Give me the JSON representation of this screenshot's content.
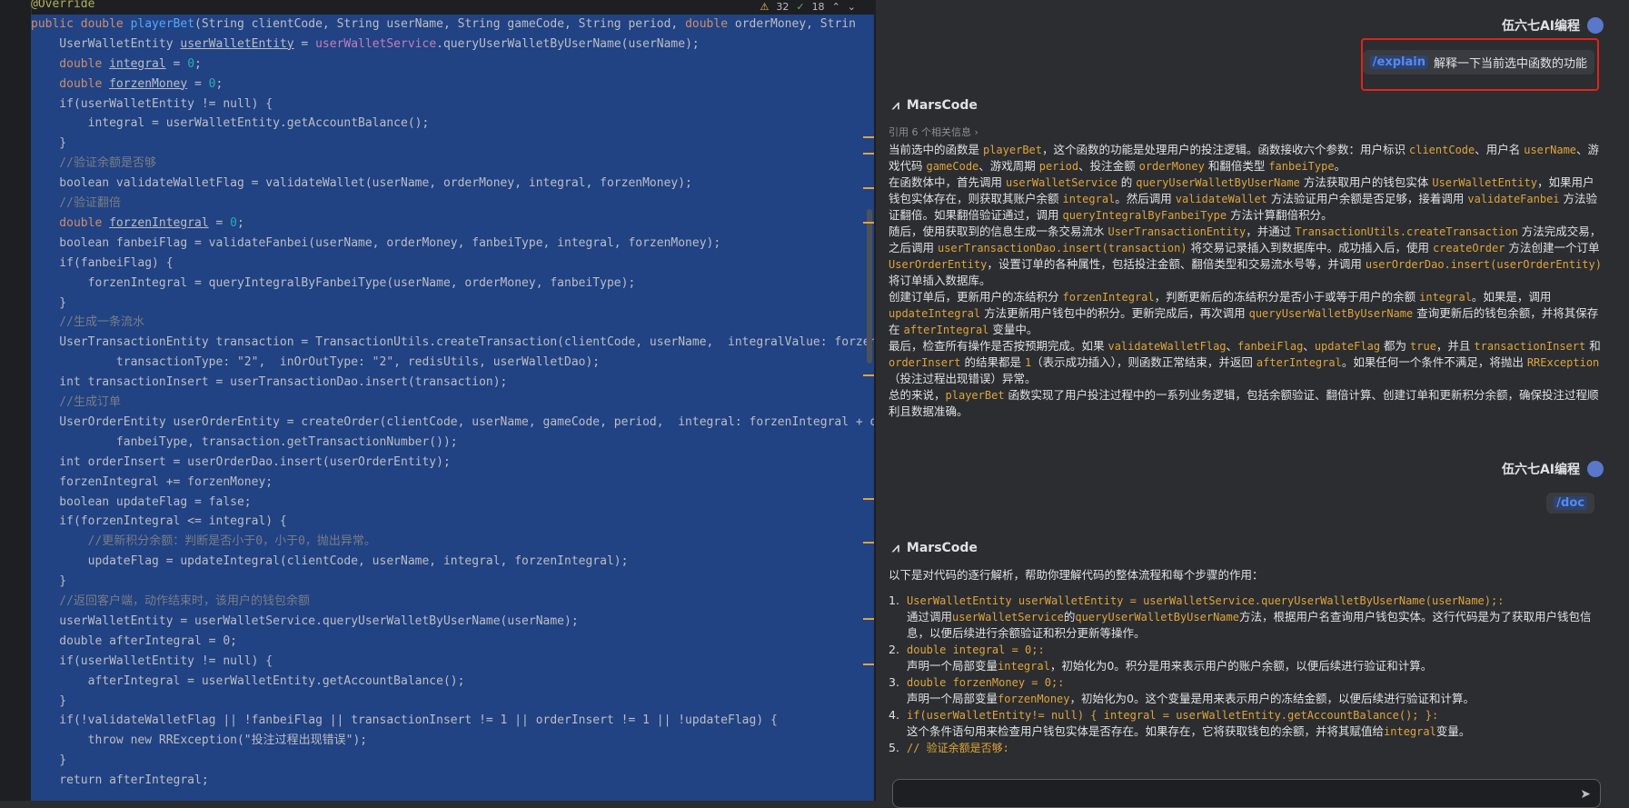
{
  "editor": {
    "inspect": {
      "warnings": "32",
      "ok": "18"
    },
    "lines": [
      {
        "t": "ann",
        "text": "@Override"
      },
      {
        "t": "sig",
        "kw": "public double ",
        "fn": "playerBet",
        "rest": "(String clientCode, String userName, String gameCode, String period, ",
        "kw2": "double ",
        "rest2": "orderMoney, Strin"
      },
      {
        "t": "plain",
        "pre": "    UserWalletEntity ",
        "u": "userWalletEntity",
        "mid": " = ",
        "fld": "userWalletService",
        "post": ".queryUserWalletByUserName(userName);"
      },
      {
        "t": "decl",
        "kw": "    double ",
        "u": "integral",
        "post": " = ",
        "num": "0",
        "end": ";"
      },
      {
        "t": "decl",
        "kw": "    double ",
        "u": "forzenMoney",
        "post": " = ",
        "num": "0",
        "end": ";"
      },
      {
        "t": "if1",
        "text": "    if(userWalletEntity != null) {"
      },
      {
        "t": "plain2",
        "text": "        integral = userWalletEntity.getAccountBalance();"
      },
      {
        "t": "plain2",
        "text": "    }"
      },
      {
        "t": "cm",
        "text": "    //验证余额是否够"
      },
      {
        "t": "plain2",
        "text": "    boolean validateWalletFlag = validateWallet(userName, orderMoney, integral, forzenMoney);"
      },
      {
        "t": "cm",
        "text": "    //验证翻倍"
      },
      {
        "t": "decl",
        "kw": "    double ",
        "u": "forzenIntegral",
        "post": " = ",
        "num": "0",
        "end": ";"
      },
      {
        "t": "plain2",
        "text": "    boolean fanbeiFlag = validateFanbei(userName, orderMoney, fanbeiType, integral, forzenMoney);"
      },
      {
        "t": "plain2",
        "text": "    if(fanbeiFlag) {"
      },
      {
        "t": "plain2",
        "text": "        forzenIntegral = queryIntegralByFanbeiType(userName, orderMoney, fanbeiType);"
      },
      {
        "t": "plain2",
        "text": "    }"
      },
      {
        "t": "cm",
        "text": "    //生成一条流水"
      },
      {
        "t": "plain2",
        "text": "    UserTransactionEntity transaction = TransactionUtils.createTransaction(clientCode, userName,  integralValue: forzenIn"
      },
      {
        "t": "plain2",
        "text": "            transactionType: \"2\",  inOrOutType: \"2\", redisUtils, userWalletDao);"
      },
      {
        "t": "plain2",
        "text": "    int transactionInsert = userTransactionDao.insert(transaction);"
      },
      {
        "t": "cm",
        "text": "    //生成订单"
      },
      {
        "t": "plain2",
        "text": "    UserOrderEntity userOrderEntity = createOrder(clientCode, userName, gameCode, period,  integral: forzenIntegral + or"
      },
      {
        "t": "plain2",
        "text": "            fanbeiType, transaction.getTransactionNumber());"
      },
      {
        "t": "plain2",
        "text": "    int orderInsert = userOrderDao.insert(userOrderEntity);"
      },
      {
        "t": "plain2",
        "text": "    forzenIntegral += forzenMoney;"
      },
      {
        "t": "plain2",
        "text": "    boolean updateFlag = false;"
      },
      {
        "t": "plain2",
        "text": "    if(forzenIntegral <= integral) {"
      },
      {
        "t": "cm",
        "text": "        //更新积分余额：判断是否小于0，小于0，抛出异常。"
      },
      {
        "t": "plain2",
        "text": "        updateFlag = updateIntegral(clientCode, userName, integral, forzenIntegral);"
      },
      {
        "t": "plain2",
        "text": "    }"
      },
      {
        "t": "cm",
        "text": "    //返回客户端，动作结束时，该用户的钱包余额"
      },
      {
        "t": "plain2",
        "text": "    userWalletEntity = userWalletService.queryUserWalletByUserName(userName);"
      },
      {
        "t": "plain2",
        "text": "    double afterIntegral = 0;"
      },
      {
        "t": "plain2",
        "text": "    if(userWalletEntity != null) {"
      },
      {
        "t": "plain2",
        "text": "        afterIntegral = userWalletEntity.getAccountBalance();"
      },
      {
        "t": "plain2",
        "text": "    }"
      },
      {
        "t": "plain2",
        "text": "    if(!validateWalletFlag || !fanbeiFlag || transactionInsert != 1 || orderInsert != 1 || !updateFlag) {"
      },
      {
        "t": "plain2",
        "text": "        throw new RRException(\"投注过程出现错误\");"
      },
      {
        "t": "plain2",
        "text": "    }"
      },
      {
        "t": "plain2",
        "text": "    return afterIntegral;"
      }
    ]
  },
  "chat": {
    "user_name": "伍六七AI编程",
    "msg1_cmd": "/explain",
    "msg1_text": "解释一下当前选中函数的功能",
    "bot_name": "MarsCode",
    "refs": "引用 6 个相关信息 ›",
    "answer1": [
      [
        [
          "t",
          "当前选中的函数是 "
        ],
        [
          "c",
          "playerBet"
        ],
        [
          "t",
          "，这个函数的功能是处理用户的投注逻辑。函数接收六个参数：用户标识 "
        ],
        [
          "c",
          "clientCode"
        ],
        [
          "t",
          "、用户名 "
        ],
        [
          "c",
          "userName"
        ],
        [
          "t",
          "、游戏代码 "
        ],
        [
          "c",
          "gameCode"
        ],
        [
          "t",
          "、游戏周期 "
        ],
        [
          "c",
          "period"
        ],
        [
          "t",
          "、投注金额 "
        ],
        [
          "c",
          "orderMoney"
        ],
        [
          "t",
          " 和翻倍类型 "
        ],
        [
          "c",
          "fanbeiType"
        ],
        [
          "t",
          "。"
        ]
      ],
      [
        [
          "t",
          "在函数体中，首先调用 "
        ],
        [
          "c",
          "userWalletService"
        ],
        [
          "t",
          " 的 "
        ],
        [
          "c",
          "queryUserWalletByUserName"
        ],
        [
          "t",
          " 方法获取用户的钱包实体 "
        ],
        [
          "c",
          "UserWalletEntity"
        ],
        [
          "t",
          "，如果用户钱包实体存在，则获取其账户余额 "
        ],
        [
          "c",
          "integral"
        ],
        [
          "t",
          "。然后调用 "
        ],
        [
          "c",
          "validateWallet"
        ],
        [
          "t",
          " 方法验证用户余额是否足够，接着调用 "
        ],
        [
          "c",
          "validateFanbei"
        ],
        [
          "t",
          " 方法验证翻倍。如果翻倍验证通过，调用 "
        ],
        [
          "c",
          "queryIntegralByFanbeiType"
        ],
        [
          "t",
          " 方法计算翻倍积分。"
        ]
      ],
      [
        [
          "t",
          "随后，使用获取到的信息生成一条交易流水 "
        ],
        [
          "c",
          "UserTransactionEntity"
        ],
        [
          "t",
          "，并通过 "
        ],
        [
          "c",
          "TransactionUtils.createTransaction"
        ],
        [
          "t",
          " 方法完成交易，之后调用 "
        ],
        [
          "c",
          "userTransactionDao.insert(transaction)"
        ],
        [
          "t",
          " 将交易记录插入到数据库中。成功插入后，使用 "
        ],
        [
          "c",
          "createOrder"
        ],
        [
          "t",
          " 方法创建一个订单 "
        ],
        [
          "c",
          "UserOrderEntity"
        ],
        [
          "t",
          "，设置订单的各种属性，包括投注金额、翻倍类型和交易流水号等，并调用 "
        ],
        [
          "c",
          "userOrderDao.insert(userOrderEntity)"
        ],
        [
          "t",
          " 将订单插入数据库。"
        ]
      ],
      [
        [
          "t",
          "创建订单后，更新用户的冻结积分 "
        ],
        [
          "c",
          "forzenIntegral"
        ],
        [
          "t",
          "，判断更新后的冻结积分是否小于或等于用户的余额 "
        ],
        [
          "c",
          "integral"
        ],
        [
          "t",
          "。如果是，调用 "
        ],
        [
          "c",
          "updateIntegral"
        ],
        [
          "t",
          " 方法更新用户钱包中的积分。更新完成后，再次调用 "
        ],
        [
          "c",
          "queryUserWalletByUserName"
        ],
        [
          "t",
          " 查询更新后的钱包余额，并将其保存在 "
        ],
        [
          "c",
          "afterIntegral"
        ],
        [
          "t",
          " 变量中。"
        ]
      ],
      [
        [
          "t",
          "最后，检查所有操作是否按预期完成。如果 "
        ],
        [
          "c",
          "validateWalletFlag"
        ],
        [
          "t",
          "、"
        ],
        [
          "c",
          "fanbeiFlag"
        ],
        [
          "t",
          "、"
        ],
        [
          "c",
          "updateFlag"
        ],
        [
          "t",
          " 都为 "
        ],
        [
          "c",
          "true"
        ],
        [
          "t",
          "，并且 "
        ],
        [
          "c",
          "transactionInsert"
        ],
        [
          "t",
          " 和 "
        ],
        [
          "c",
          "orderInsert"
        ],
        [
          "t",
          " 的结果都是 "
        ],
        [
          "c",
          "1"
        ],
        [
          "t",
          "（表示成功插入），则函数正常结束，并返回 "
        ],
        [
          "c",
          "afterIntegral"
        ],
        [
          "t",
          "。如果任何一个条件不满足，将抛出 "
        ],
        [
          "c",
          "RRException"
        ],
        [
          "t",
          "（投注过程出现错误）异常。"
        ]
      ],
      [
        [
          "t",
          "总的来说，"
        ],
        [
          "c",
          "playerBet"
        ],
        [
          "t",
          " 函数实现了用户投注过程中的一系列业务逻辑，包括余额验证、翻倍计算、创建订单和更新积分余额，确保投注过程顺利且数据准确。"
        ]
      ]
    ],
    "msg2_cmd": "/doc",
    "answer2_intro": "以下是对代码的逐行解析，帮助你理解代码的整体流程和每个步骤的作用：",
    "steps": [
      {
        "n": "1.",
        "code": "UserWalletEntity userWalletEntity = userWalletService.queryUserWalletByUserName(userName);:",
        "desc": [
          [
            "t",
            "通过调用"
          ],
          [
            "h",
            "userWalletService"
          ],
          [
            "t",
            "的"
          ],
          [
            "h",
            "queryUserWalletByUserName"
          ],
          [
            "t",
            "方法，根据用户名查询用户钱包实体。这行代码是为了获取用户钱包信息，以便后续进行余额验证和积分更新等操作。"
          ]
        ]
      },
      {
        "n": "2.",
        "code": "double integral = 0;:",
        "desc": [
          [
            "t",
            "声明一个局部变量"
          ],
          [
            "h",
            "integral"
          ],
          [
            "t",
            "，初始化为0。积分是用来表示用户的账户余额，以便后续进行验证和计算。"
          ]
        ]
      },
      {
        "n": "3.",
        "code": "double forzenMoney = 0;:",
        "desc": [
          [
            "t",
            "声明一个局部变量"
          ],
          [
            "h",
            "forzenMoney"
          ],
          [
            "t",
            "，初始化为0。这个变量是用来表示用户的冻结金额，以便后续进行验证和计算。"
          ]
        ]
      },
      {
        "n": "4.",
        "code": "if(userWalletEntity!= null) { integral = userWalletEntity.getAccountBalance(); }:",
        "desc": [
          [
            "t",
            "这个条件语句用来检查用户钱包实体是否存在。如果存在，它将获取钱包的余额，并将其赋值给"
          ],
          [
            "h",
            "integral"
          ],
          [
            "t",
            "变量。"
          ]
        ]
      },
      {
        "n": "5.",
        "code": "// 验证余额是否够:",
        "desc": []
      }
    ]
  }
}
